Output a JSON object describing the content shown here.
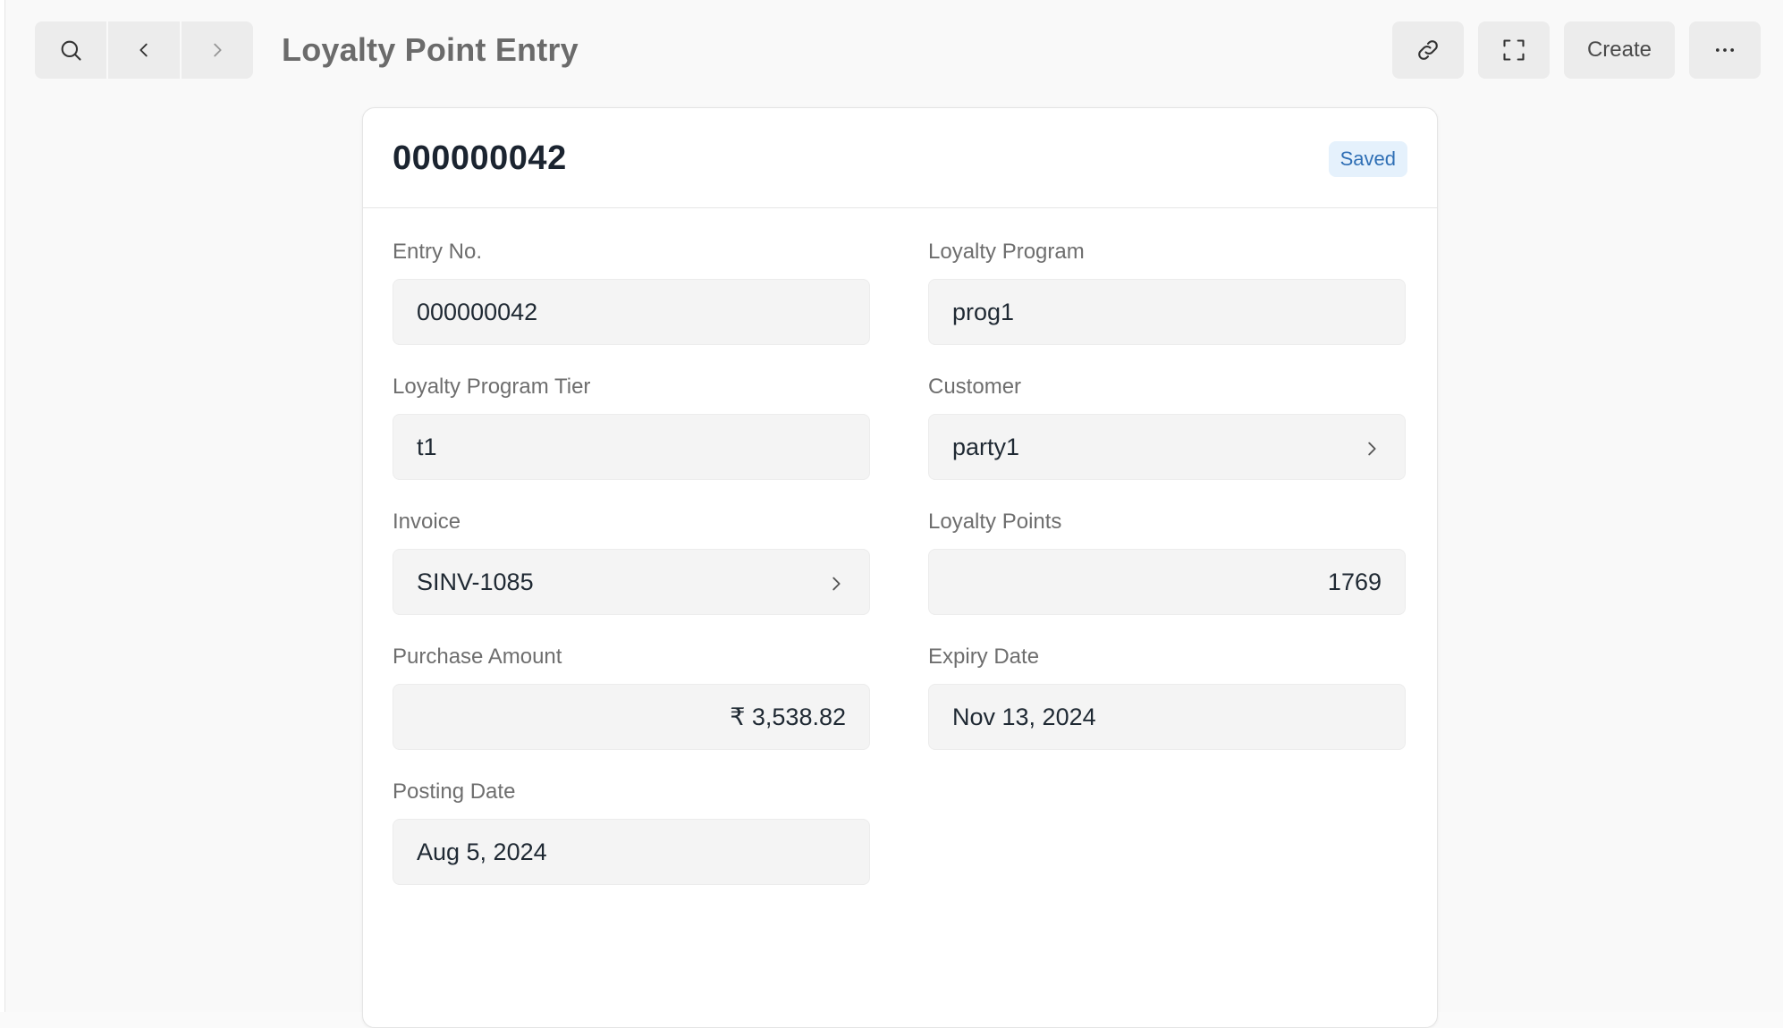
{
  "toolbar": {
    "title": "Loyalty Point Entry",
    "create_label": "Create"
  },
  "icons": {
    "search": "search-icon",
    "back": "chevron-left-icon",
    "forward": "chevron-right-icon",
    "link": "link-icon",
    "fullscreen": "fullscreen-icon",
    "more": "ellipsis-icon"
  },
  "document": {
    "name": "000000042",
    "status": "Saved"
  },
  "fields": {
    "entry_no": {
      "label": "Entry No.",
      "value": "000000042"
    },
    "loyalty_program": {
      "label": "Loyalty Program",
      "value": "prog1"
    },
    "loyalty_program_tier": {
      "label": "Loyalty Program Tier",
      "value": "t1"
    },
    "customer": {
      "label": "Customer",
      "value": "party1"
    },
    "invoice": {
      "label": "Invoice",
      "value": "SINV-1085"
    },
    "loyalty_points": {
      "label": "Loyalty Points",
      "value": "1769"
    },
    "purchase_amount": {
      "label": "Purchase Amount",
      "value": "₹ 3,538.82"
    },
    "expiry_date": {
      "label": "Expiry Date",
      "value": "Nov 13, 2024"
    },
    "posting_date": {
      "label": "Posting Date",
      "value": "Aug 5, 2024"
    }
  },
  "colors": {
    "badge_bg": "#e5f1fc",
    "badge_text": "#2f6fb5",
    "toolbar_button": "#ececec"
  }
}
